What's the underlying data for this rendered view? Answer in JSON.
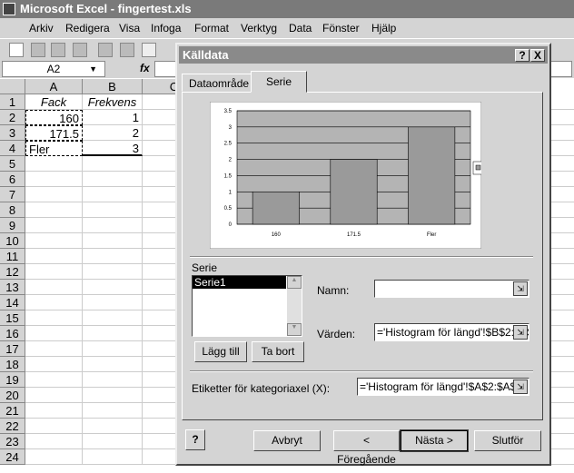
{
  "window": {
    "title": "Microsoft Excel - fingertest.xls"
  },
  "menu": [
    "Arkiv",
    "Redigera",
    "Visa",
    "Infoga",
    "Format",
    "Verktyg",
    "Data",
    "Fönster",
    "Hjälp"
  ],
  "formula_bar": {
    "name_box": "A2",
    "fx": "fx"
  },
  "sheet": {
    "columns": [
      "A",
      "B",
      "C"
    ],
    "rows": [
      "1",
      "2",
      "3",
      "4",
      "5",
      "6",
      "7",
      "8",
      "9",
      "10",
      "11",
      "12",
      "13",
      "14",
      "15",
      "16",
      "17",
      "18",
      "19",
      "20",
      "21",
      "22",
      "23",
      "24"
    ],
    "cells": [
      [
        "Fack",
        "Frekvens"
      ],
      [
        "160",
        "1"
      ],
      [
        "171.5",
        "2"
      ],
      [
        "Fler",
        "3"
      ]
    ]
  },
  "dialog": {
    "title": "Källdata",
    "help": "?",
    "close": "X",
    "tabs": [
      "Dataområde",
      "Serie"
    ],
    "series_label": "Serie",
    "series_list": [
      "Serie1"
    ],
    "name_label": "Namn:",
    "name_value": "",
    "values_label": "Värden:",
    "values_value": "='Histogram för längd'!$B$2:$B$4",
    "add_button": "Lägg till",
    "remove_button": "Ta bort",
    "category_label": "Etiketter för kategoriaxel (X):",
    "category_value": "='Histogram för längd'!$A$2:$A$4",
    "buttons": {
      "help": "?",
      "cancel": "Avbryt",
      "back": "< Föregående",
      "next": "Nästa >",
      "finish": "Slutför"
    }
  },
  "chart_data": {
    "type": "bar",
    "categories": [
      "160",
      "171.5",
      "Fler"
    ],
    "series": [
      {
        "name": "Serie1",
        "values": [
          1,
          2,
          3
        ]
      }
    ],
    "ylim": [
      0,
      3.5
    ],
    "yticks": [
      "0",
      "0.5",
      "1",
      "1.5",
      "2",
      "2.5",
      "3",
      "3.5"
    ],
    "grid": true,
    "legend": "right",
    "colors": {
      "plot": "#b4b4b4",
      "bar": "#9a9a9a"
    }
  }
}
